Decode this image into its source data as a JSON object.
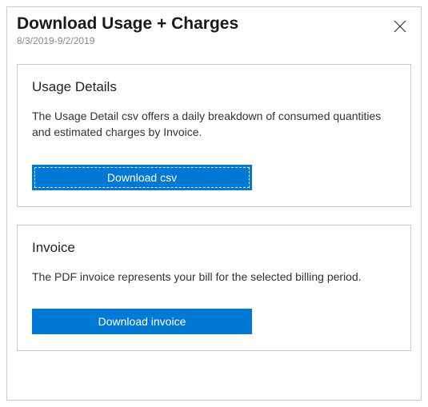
{
  "header": {
    "title": "Download Usage + Charges",
    "date_range": "8/3/2019-9/2/2019"
  },
  "usage_details": {
    "title": "Usage Details",
    "description": "The Usage Detail csv offers a daily breakdown of consumed quantities and estimated charges by Invoice.",
    "button_label": "Download csv"
  },
  "invoice": {
    "title": "Invoice",
    "description": "The PDF invoice represents your bill for the selected billing period.",
    "button_label": "Download invoice"
  }
}
